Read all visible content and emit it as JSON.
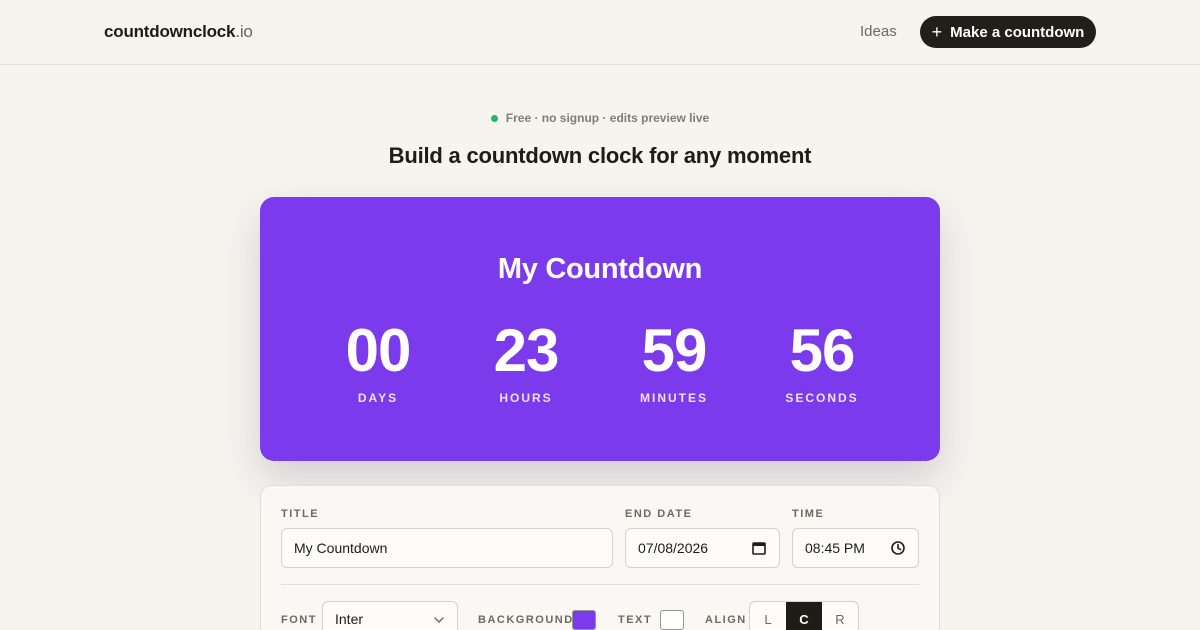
{
  "header": {
    "brand_main": "countdownclock",
    "brand_tld": ".io",
    "nav_ideas": "Ideas",
    "cta_label": "Make a countdown",
    "cta_icon": "plus-icon"
  },
  "hero": {
    "tagline": "Free · no signup · edits preview live",
    "status_dot_color": "#27b36a",
    "headline": "Build a countdown clock for any moment"
  },
  "clock": {
    "background_color": "#7c3aed",
    "text_color": "#ffffff",
    "title": "My Countdown",
    "units": [
      {
        "value": "00",
        "label": "DAYS"
      },
      {
        "value": "23",
        "label": "HOURS"
      },
      {
        "value": "59",
        "label": "MINUTES"
      },
      {
        "value": "56",
        "label": "SECONDS"
      }
    ]
  },
  "editor": {
    "title_label": "TITLE",
    "title_value": "My Countdown",
    "end_date_label": "END DATE",
    "end_date_value": "07/08/2026",
    "end_date_icon": "calendar-icon",
    "time_label": "TIME",
    "time_value": "08:45 PM",
    "time_icon": "clock-icon",
    "font_label": "FONT",
    "font_value": "Inter",
    "background_label": "BACKGROUND",
    "background_swatch": "#7c3aed",
    "text_label": "TEXT",
    "text_swatch": "#ffffff",
    "align_label": "ALIGN",
    "align_options": [
      "L",
      "C",
      "R"
    ],
    "align_selected": "C"
  }
}
